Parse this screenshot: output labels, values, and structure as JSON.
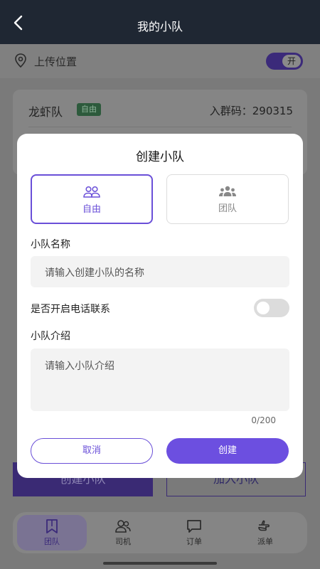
{
  "header": {
    "title": "我的小队"
  },
  "page": {
    "upload_label": "上传位置",
    "upload_toggle_text": "开",
    "team": {
      "name": "龙虾队",
      "badge": "自由",
      "code": "入群码：290315"
    },
    "create_team_label": "创建小队",
    "join_team_label": "加入小队"
  },
  "tabbar": {
    "items": [
      {
        "label": "团队"
      },
      {
        "label": "司机"
      },
      {
        "label": "订单"
      },
      {
        "label": "派单"
      }
    ]
  },
  "modal": {
    "title": "创建小队",
    "types": [
      {
        "label": "自由"
      },
      {
        "label": "团队"
      }
    ],
    "name_label": "小队名称",
    "name_placeholder": "请输入创建小队的名称",
    "phone_label": "是否开启电话联系",
    "intro_label": "小队介绍",
    "intro_placeholder": "请输入小队介绍",
    "counter": "0/200",
    "cancel_label": "取消",
    "create_label": "创建"
  },
  "colors": {
    "accent": "#6c4fe0",
    "header_bg": "#1f2733"
  }
}
